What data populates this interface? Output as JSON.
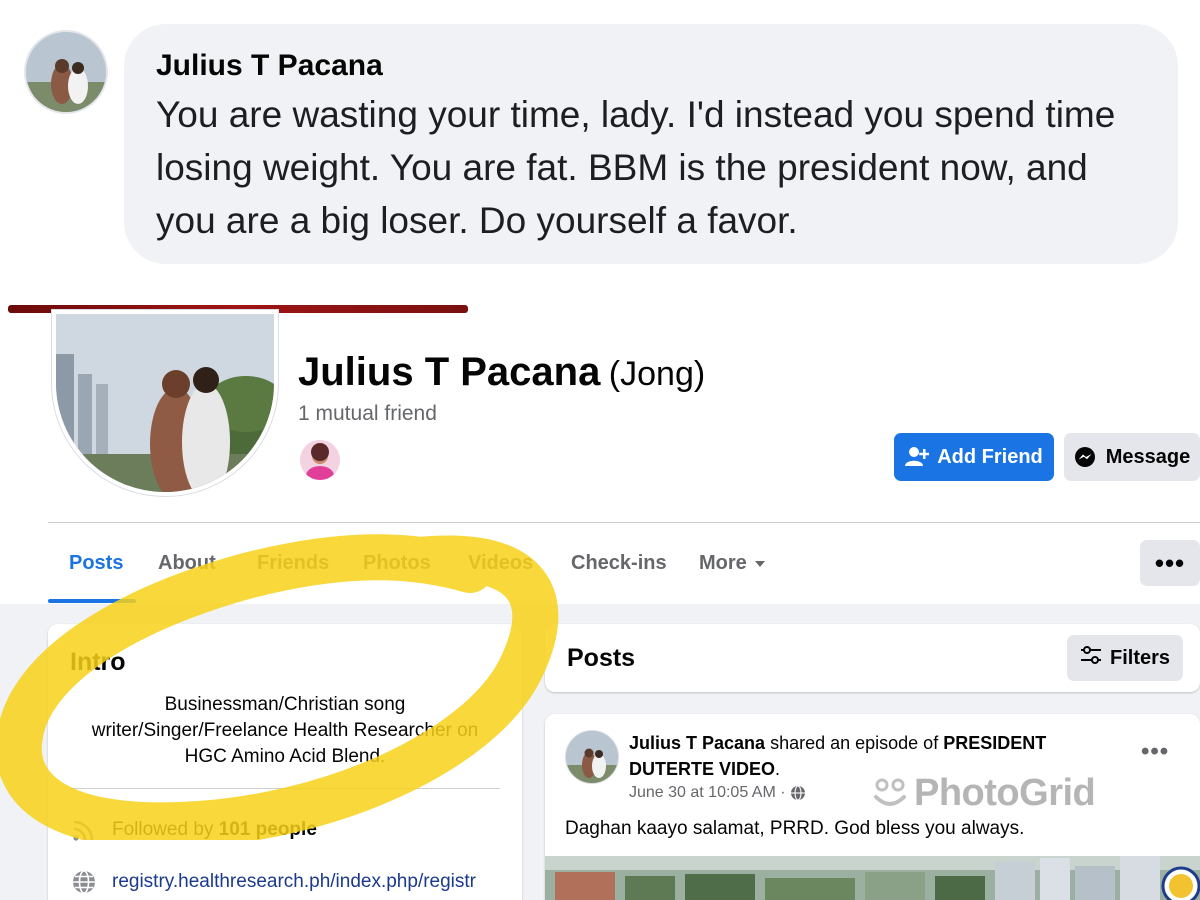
{
  "comment": {
    "author": "Julius T Pacana",
    "text": "You are wasting your time, lady. I'd instead you spend time losing weight. You are fat. BBM is the president now, and you are a big loser. Do yourself a favor."
  },
  "profile": {
    "name": "Julius T Pacana",
    "alternate_name": "(Jong)",
    "mutual_friends": "1 mutual friend",
    "add_friend_label": "Add Friend",
    "message_label": "Message"
  },
  "tabs": [
    {
      "label": "Posts",
      "active": true
    },
    {
      "label": "About"
    },
    {
      "label": "Friends"
    },
    {
      "label": "Photos"
    },
    {
      "label": "Videos"
    },
    {
      "label": "Check-ins"
    },
    {
      "label": "More"
    }
  ],
  "more_options": "•••",
  "intro": {
    "title": "Intro",
    "bio": "Businessman/Christian song writer/Singer/Freelance Health Researcher on HGC Amino Acid Blend.",
    "followed_prefix": "Followed by ",
    "followed_count": "101 people",
    "website": "registry.healthresearch.ph/index.php/registr"
  },
  "posts_section": {
    "title": "Posts",
    "filters_label": "Filters"
  },
  "post": {
    "author": "Julius T Pacana",
    "action": " shared an episode of ",
    "shared_title": "PRESIDENT DUTERTE VIDEO",
    "period": ".",
    "time": "June 30 at 10:05 AM · ",
    "text": "Daghan kaayo salamat, PRRD. God bless you always.",
    "menu": "•••"
  },
  "watermark": "PhotoGrid",
  "colors": {
    "facebook_blue": "#1b74e4",
    "highlight_yellow": "#f7d118",
    "secondary_gray": "#65676b"
  }
}
